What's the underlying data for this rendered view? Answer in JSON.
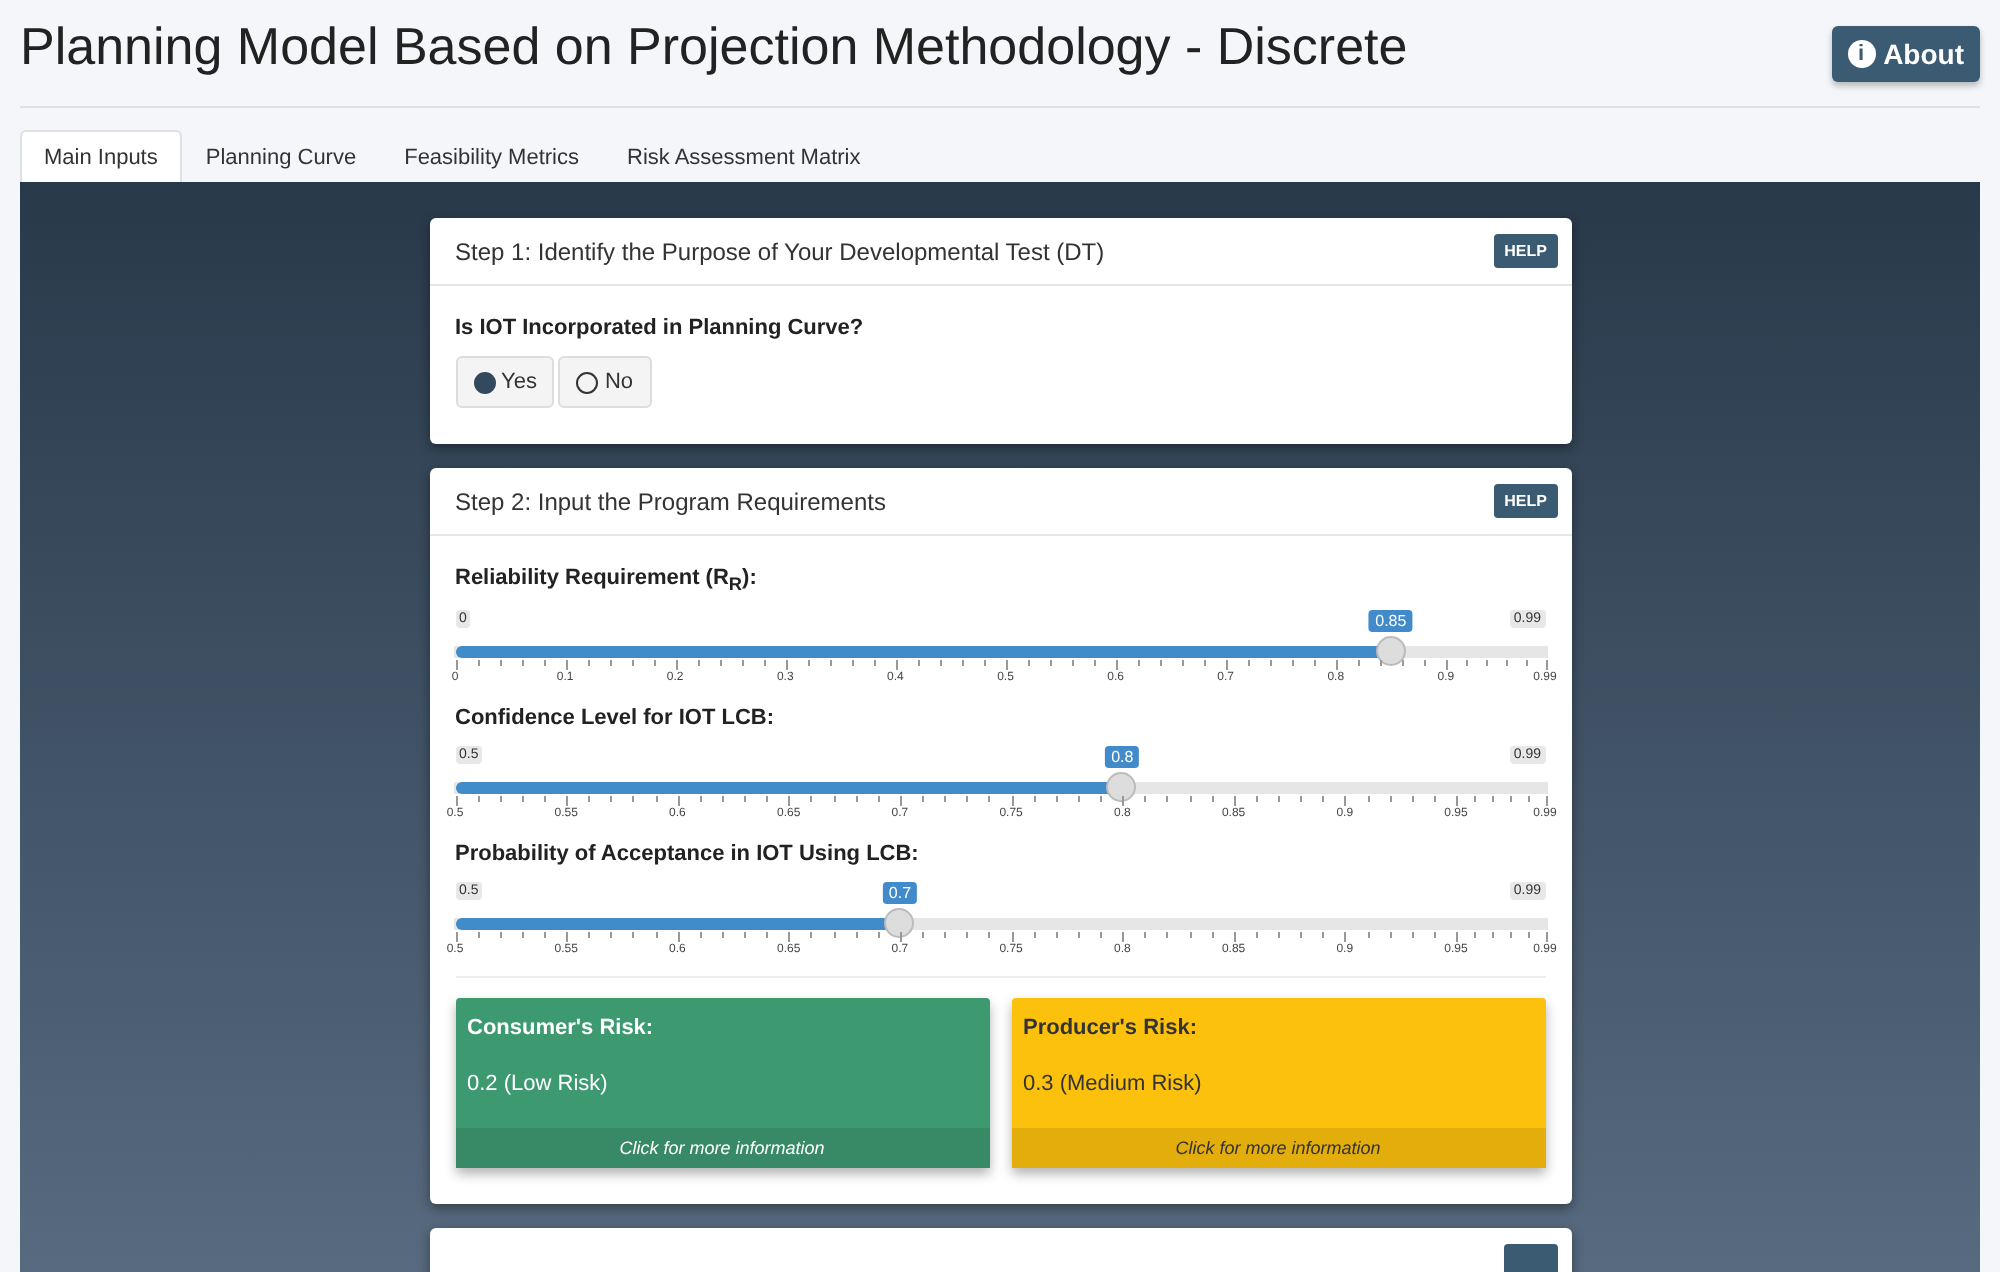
{
  "title": "Planning Model Based on Projection Methodology - Discrete",
  "about_button": {
    "icon": "i",
    "label": "About"
  },
  "tabs": [
    {
      "label": "Main Inputs",
      "selected": true
    },
    {
      "label": "Planning Curve",
      "selected": false
    },
    {
      "label": "Feasibility Metrics",
      "selected": false
    },
    {
      "label": "Risk Assessment Matrix",
      "selected": false
    }
  ],
  "step1": {
    "title": "Step 1: Identify the Purpose of Your Developmental Test (DT)",
    "help": "HELP",
    "question": "Is IOT Incorporated in Planning Curve?",
    "options": [
      {
        "label": "Yes",
        "selected": true
      },
      {
        "label": "No",
        "selected": false
      }
    ]
  },
  "step2": {
    "title": "Step 2: Input the Program Requirements",
    "help": "HELP",
    "sliders": [
      {
        "label": "Reliability Requirement (R$_{R}$):",
        "min": "0",
        "max": "0.99",
        "value": "0.85",
        "level": 0.8586,
        "ticks": [
          "0",
          "0.1",
          "0.2",
          "0.3",
          "0.4",
          "0.5",
          "0.6",
          "0.7",
          "0.8",
          "0.9",
          "0.99"
        ]
      },
      {
        "label": "Confidence Level for IOT LCB:",
        "min": "0.5",
        "max": "0.99",
        "value": "0.8",
        "level": 0.6122,
        "ticks": [
          "0.5",
          "0.55",
          "0.6",
          "0.65",
          "0.7",
          "0.75",
          "0.8",
          "0.85",
          "0.9",
          "0.95",
          "0.99"
        ]
      },
      {
        "label": "Probability of Acceptance in IOT Using LCB:",
        "min": "0.5",
        "max": "0.99",
        "value": "0.7",
        "level": 0.4082,
        "ticks": [
          "0.5",
          "0.55",
          "0.6",
          "0.65",
          "0.7",
          "0.75",
          "0.8",
          "0.85",
          "0.9",
          "0.95",
          "0.99"
        ]
      }
    ],
    "risks": [
      {
        "title": "Consumer's Risk:",
        "value": "0.2 (Low Risk)",
        "link": "Click for more information",
        "color": "#3d9970"
      },
      {
        "title": "Producer's Risk:",
        "value": "0.3 (Medium Risk)",
        "link": "Click for more information",
        "color": "#fcc10c"
      }
    ]
  }
}
